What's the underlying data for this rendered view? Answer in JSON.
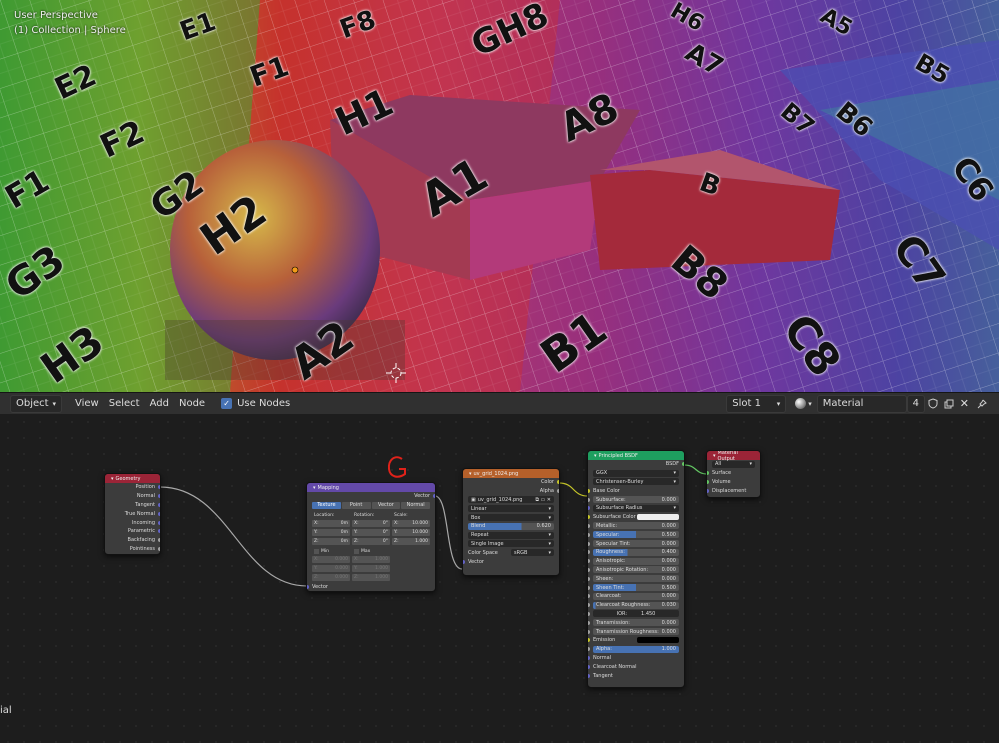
{
  "viewport": {
    "perspective_label": "User Perspective",
    "collection_label": "(1) Collection | Sphere",
    "grid_labels": [
      "F8",
      "F1",
      "E1",
      "E2",
      "F2",
      "F1",
      "GH8",
      "H1",
      "A8",
      "A1",
      "H2",
      "G2",
      "G3",
      "H3",
      "A2",
      "B1",
      "B8",
      "C8",
      "C7",
      "C6",
      "B6",
      "B7",
      "B5",
      "A5",
      "A7",
      "H6",
      "B"
    ]
  },
  "header": {
    "mode": "Object",
    "menu": [
      "View",
      "Select",
      "Add",
      "Node"
    ],
    "use_nodes_label": "Use Nodes",
    "slot": "Slot 1",
    "material_name": "Material",
    "user_count": "4"
  },
  "bottom_left_text": "ial",
  "annotation_letter": "G",
  "nodes": {
    "geometry": {
      "title": "Geometry",
      "outputs": [
        "Position",
        "Normal",
        "Tangent",
        "True Normal",
        "Incoming",
        "Parametric",
        "Backfacing",
        "Pointiness"
      ]
    },
    "mapping": {
      "title": "Mapping",
      "output": "Vector",
      "types": [
        "Texture",
        "Point",
        "Vector",
        "Normal"
      ],
      "location_label": "Location:",
      "rotation_label": "Rotation:",
      "scale_label": "Scale:",
      "location": [
        {
          "a": "X:",
          "v": "0m"
        },
        {
          "a": "Y:",
          "v": "0m"
        },
        {
          "a": "Z:",
          "v": "0m"
        }
      ],
      "rotation": [
        {
          "a": "X:",
          "v": "0°"
        },
        {
          "a": "Y:",
          "v": "0°"
        },
        {
          "a": "Z:",
          "v": "0°"
        }
      ],
      "scale": [
        {
          "a": "X:",
          "v": "10.000"
        },
        {
          "a": "Y:",
          "v": "10.000"
        },
        {
          "a": "Z:",
          "v": "1.000"
        }
      ],
      "min_label": "Min",
      "max_label": "Max",
      "min": [
        {
          "a": "X:",
          "v": "0.000"
        },
        {
          "a": "Y:",
          "v": "0.000"
        },
        {
          "a": "Z:",
          "v": "0.000"
        }
      ],
      "max": [
        {
          "a": "X:",
          "v": "1.000"
        },
        {
          "a": "Y:",
          "v": "1.000"
        },
        {
          "a": "Z:",
          "v": "1.000"
        }
      ],
      "input": "Vector"
    },
    "image_texture": {
      "title": "uv_grid_1024.png",
      "outputs": [
        "Color",
        "Alpha"
      ],
      "image": "uv_grid_1024.png",
      "interpolation": "Linear",
      "projection": "Box",
      "blend_label": "Blend",
      "blend_value": "0.620",
      "blend_fraction": 0.62,
      "extension": "Repeat",
      "source": "Single Image",
      "color_space_label": "Color Space",
      "color_space": "sRGB",
      "input": "Vector"
    },
    "principled": {
      "title": "Principled BSDF",
      "output": "BSDF",
      "distribution": "GGX",
      "subsurface_method": "Christensen-Burley",
      "base_color_label": "Base Color",
      "subsurface_label": "Subsurface:",
      "subsurface_value": "0.000",
      "subsurface_radius_label": "Subsurface Radius",
      "subsurface_color_label": "Subsurface Color",
      "params": [
        {
          "label": "Metallic:",
          "value": "0.000",
          "fill": 0
        },
        {
          "label": "Specular:",
          "value": "0.500",
          "fill": 0.5
        },
        {
          "label": "Specular Tint:",
          "value": "0.000",
          "fill": 0
        },
        {
          "label": "Roughness:",
          "value": "0.400",
          "fill": 0.4
        },
        {
          "label": "Anisotropic:",
          "value": "0.000",
          "fill": 0
        },
        {
          "label": "Anisotropic Rotation:",
          "value": "0.000",
          "fill": 0
        },
        {
          "label": "Sheen:",
          "value": "0.000",
          "fill": 0
        },
        {
          "label": "Sheen Tint:",
          "value": "0.500",
          "fill": 0.5
        },
        {
          "label": "Clearcoat:",
          "value": "0.000",
          "fill": 0
        },
        {
          "label": "Clearcoat Roughness:",
          "value": "0.030",
          "fill": 0.03
        }
      ],
      "ior_label": "IOR:",
      "ior_value": "1.450",
      "params2": [
        {
          "label": "Transmission:",
          "value": "0.000",
          "fill": 0
        },
        {
          "label": "Transmission Roughness:",
          "value": "0.000",
          "fill": 0
        }
      ],
      "emission_label": "Emission",
      "alpha_label": "Alpha:",
      "alpha_value": "1.000",
      "alpha_fill": 1,
      "inputs_tail": [
        "Normal",
        "Clearcoat Normal",
        "Tangent"
      ]
    },
    "material_output": {
      "title": "Material Output",
      "target": "All",
      "inputs": [
        "Surface",
        "Volume",
        "Displacement"
      ]
    }
  },
  "colors": {
    "geometry_header": "#9b2437",
    "mapping_header": "#6349a8",
    "texture_header": "#b5602a",
    "shader_header": "#1e9e5f",
    "output_header": "#9b2437",
    "accent": "#4772b3",
    "annotation": "#e0221a"
  }
}
